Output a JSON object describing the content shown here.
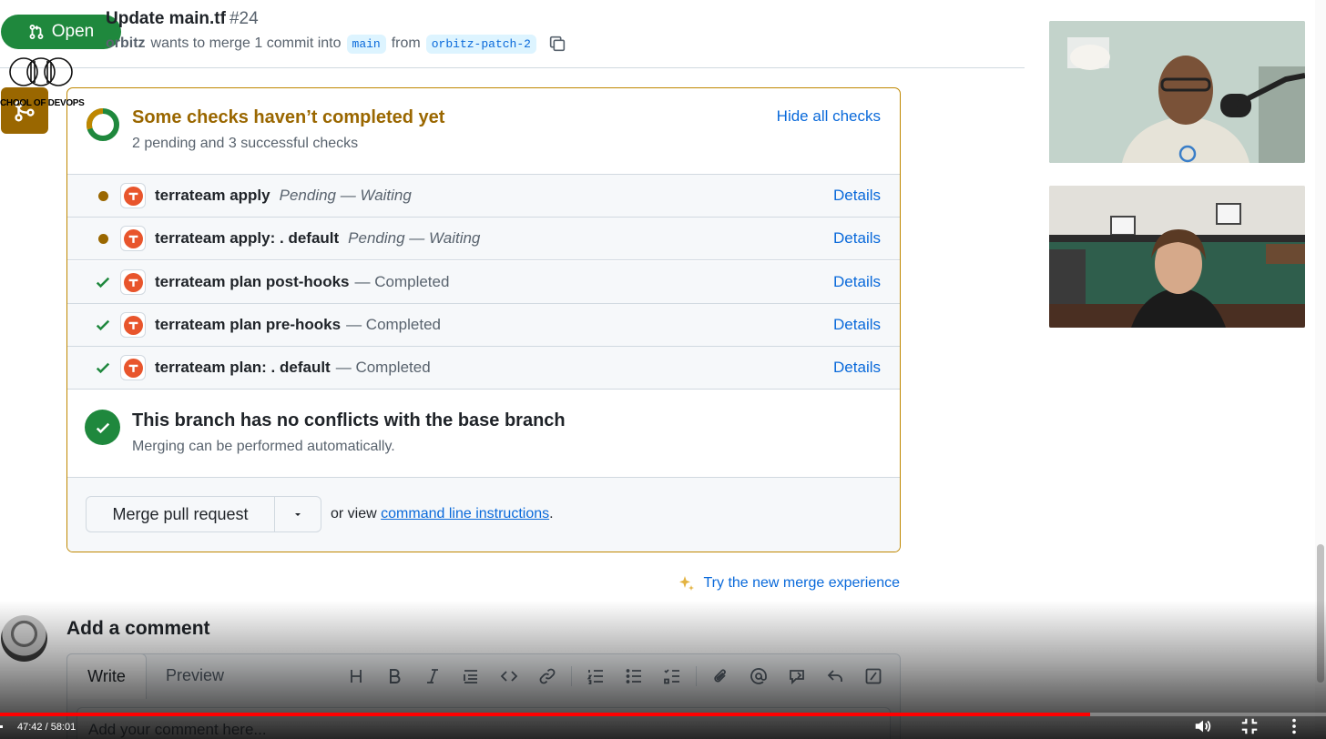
{
  "pr": {
    "state_label": "Open",
    "title": "Update main.tf",
    "number": "#24",
    "author": "orbitz",
    "merge_text": "wants to merge 1 commit into",
    "base_branch": "main",
    "from_text": "from",
    "head_branch": "orbitz-patch-2"
  },
  "logo": {
    "text": "CHOOL OF DEVOPS"
  },
  "checks": {
    "title": "Some checks haven’t completed yet",
    "summary": "2 pending and 3 successful checks",
    "hide_label": "Hide all checks",
    "items": [
      {
        "status": "pending",
        "name": "terrateam apply",
        "desc": "Pending — Waiting",
        "link": "Details"
      },
      {
        "status": "pending",
        "name": "terrateam apply: . default",
        "desc": "Pending — Waiting",
        "link": "Details"
      },
      {
        "status": "success",
        "name": "terrateam plan post-hooks",
        "desc": "— Completed",
        "link": "Details"
      },
      {
        "status": "success",
        "name": "terrateam plan pre-hooks",
        "desc": "— Completed",
        "link": "Details"
      },
      {
        "status": "success",
        "name": "terrateam plan: . default",
        "desc": "— Completed",
        "link": "Details"
      }
    ]
  },
  "conflicts": {
    "title": "This branch has no conflicts with the base branch",
    "subtitle": "Merging can be performed automatically."
  },
  "merge": {
    "button_label": "Merge pull request",
    "or_view": "or view",
    "cli_link": "command line instructions",
    "period": "."
  },
  "try_new": "Try the new merge experience",
  "comment": {
    "heading": "Add a comment",
    "tab_write": "Write",
    "tab_preview": "Preview",
    "placeholder": "Add your comment here..."
  },
  "video": {
    "timecode": "47:42 / 58:01",
    "progress": 0.822
  },
  "colors": {
    "open_green": "#1f883d",
    "pending_amber": "#9a6700",
    "link_blue": "#0969da",
    "terrateam_orange": "#e8552c"
  }
}
